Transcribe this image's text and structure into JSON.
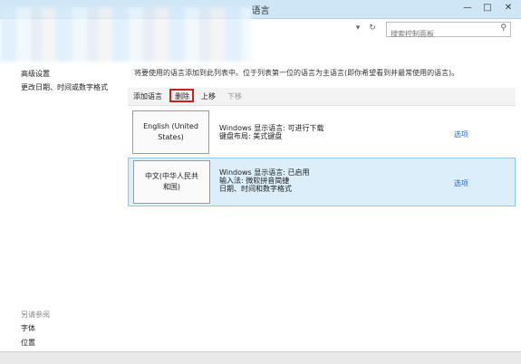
{
  "window": {
    "title": "语言",
    "minimize": "—",
    "maximize": "□",
    "close": "✕"
  },
  "address": {
    "refresh": "↻",
    "dropdown": "▾",
    "search_placeholder": "搜索控制面板",
    "search_icon": "search-icon"
  },
  "sidebar": {
    "links": [
      "高级设置",
      "更改日期、时间或数字格式"
    ],
    "see_also_heading": "另请参阅",
    "see_also": [
      "字体",
      "位置"
    ]
  },
  "main": {
    "description": "将要使用的语言添加到此列表中。位于列表第一位的语言为主语言(即你希望看到并最常使用的语言)。",
    "toolbar": {
      "add": "添加语言",
      "remove": "删除",
      "up": "上移",
      "down": "下移"
    },
    "languages": [
      {
        "name_line1": "English (United",
        "name_line2": "States)",
        "info": [
          "Windows 显示语言: 可进行下载",
          "键盘布局: 美式键盘"
        ],
        "options": "选项"
      },
      {
        "name_line1": "中文(中华人民共",
        "name_line2": "和国)",
        "info": [
          "Windows 显示语言: 已启用",
          "输入法: 微软拼音简捷",
          "日期、时间和数字格式"
        ],
        "options": "选项"
      }
    ]
  },
  "colors": {
    "highlight_row": "#dbeef9",
    "delete_border": "#c8231b",
    "link": "#2a6cbc"
  }
}
